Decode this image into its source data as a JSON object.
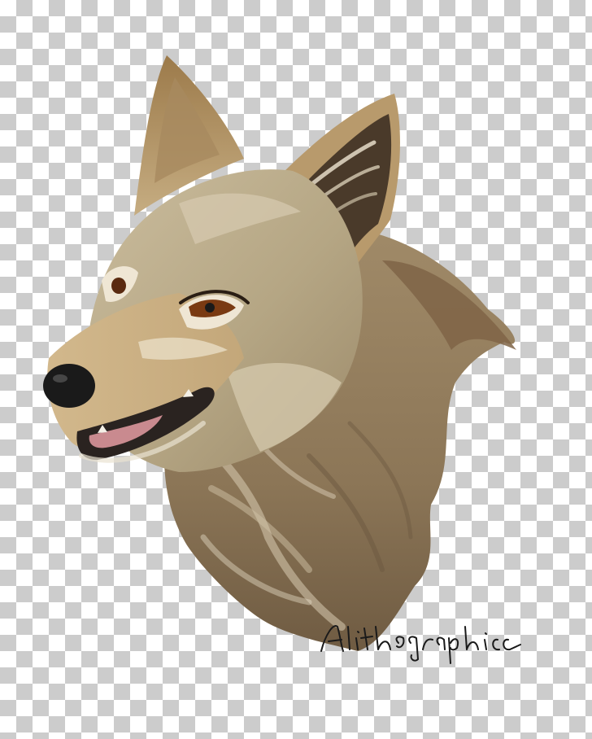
{
  "image": {
    "subject": "coyote-head-illustration",
    "background": "transparency-checkerboard",
    "signature": "Alithographica"
  },
  "colors": {
    "checker_light": "#ffffff",
    "checker_dark": "#cccccc",
    "fur_tan": "#c9b48f",
    "fur_grey": "#b4a78e",
    "fur_brown": "#8a7152",
    "ear_inner": "#4a3a2a",
    "muzzle_light": "#e9ddc4",
    "nose": "#1a1a1a",
    "tongue": "#c98a8f",
    "eye": "#7a3a12"
  }
}
